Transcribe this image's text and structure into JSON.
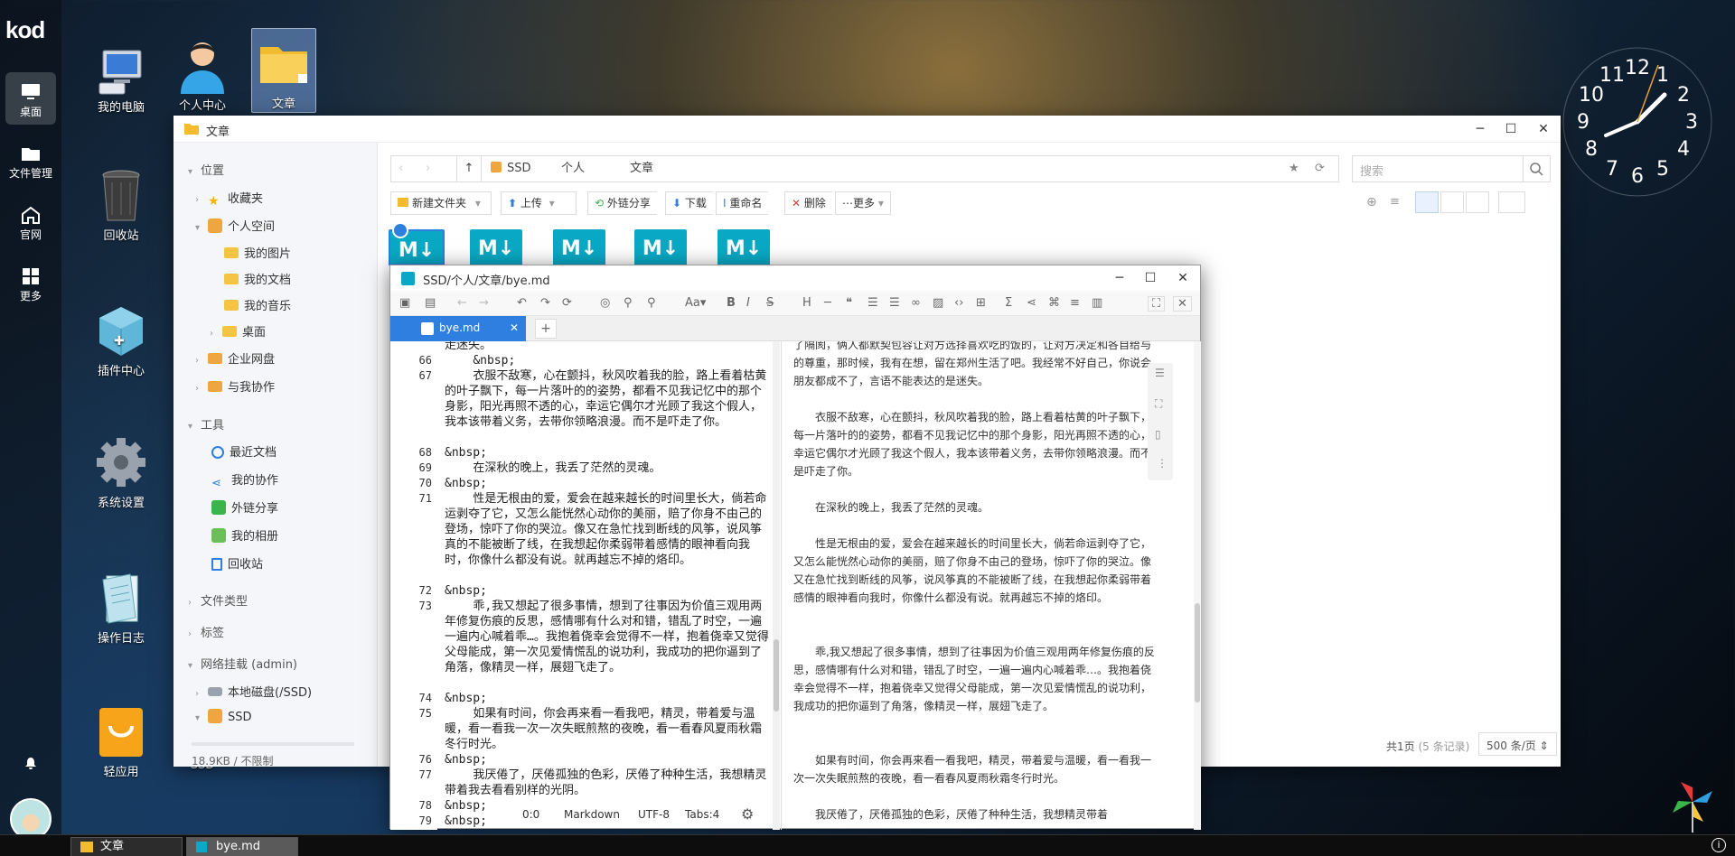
{
  "brand": "kod",
  "dock": {
    "items": [
      {
        "label": "桌面",
        "icon": "desktop-icon"
      },
      {
        "label": "文件管理",
        "icon": "folder-icon"
      },
      {
        "label": "官网",
        "icon": "home-icon"
      },
      {
        "label": "更多",
        "icon": "grid-icon"
      }
    ]
  },
  "desktop": {
    "icons": [
      {
        "label": "我的电脑",
        "icon": "computer-icon"
      },
      {
        "label": "个人中心",
        "icon": "user-icon"
      },
      {
        "label": "文章",
        "icon": "folder-icon"
      },
      {
        "label": "回收站",
        "icon": "trash-icon"
      },
      {
        "label": "插件中心",
        "icon": "plugin-icon"
      },
      {
        "label": "系统设置",
        "icon": "gear-icon"
      },
      {
        "label": "操作日志",
        "icon": "notebook-icon"
      },
      {
        "label": "轻应用",
        "icon": "bag-icon"
      },
      {
        "label": "SSD",
        "icon": "disk-icon"
      }
    ]
  },
  "clock": {
    "numbers": [
      "12",
      "1",
      "2",
      "3",
      "4",
      "5",
      "6",
      "7",
      "8",
      "9",
      "10",
      "11"
    ],
    "time": "1:36"
  },
  "explorer": {
    "title": "文章",
    "sidebar": {
      "location_label": "位置",
      "favorites": "收藏夹",
      "personal_space": "个人空间",
      "my_pictures": "我的图片",
      "my_documents": "我的文档",
      "my_music": "我的音乐",
      "desktop": "桌面",
      "enterprise_disk": "企业网盘",
      "collab_with_me": "与我协作",
      "tools_label": "工具",
      "recent_docs": "最近文档",
      "my_collab": "我的协作",
      "external_share": "外链分享",
      "my_album": "我的相册",
      "recycle": "回收站",
      "file_type": "文件类型",
      "tags": "标签",
      "network_mount": "网络挂载 (admin)",
      "local_disk": "本地磁盘(/SSD)",
      "ssd": "SSD",
      "storage": "18.9KB / 不限制"
    },
    "crumbs": [
      "SSD",
      "个人",
      "文章"
    ],
    "search_placeholder": "搜索",
    "toolbar": {
      "new_folder": "新建文件夹",
      "upload": "上传",
      "external_share": "外链分享",
      "download": "下载",
      "rename": "重命名",
      "delete": "删除",
      "more": "更多"
    },
    "thumb_label": "M↓",
    "pager": {
      "pages": "共1页",
      "records": "(5 条记录)",
      "per_page": "500 条/页"
    }
  },
  "editor": {
    "title": "SSD/个人/文章/bye.md",
    "tab": "bye.md",
    "status": {
      "cursor": "0:0",
      "mode": "Markdown",
      "encoding": "UTF-8",
      "tabs": "Tabs:4"
    },
    "lines": [
      {
        "n": "",
        "t": "走迷失。"
      },
      {
        "n": "66",
        "t": "    &nbsp;"
      },
      {
        "n": "67",
        "t": "    衣服不敌寒，心在颤抖，秋风吹着我的脸，路上看着枯黄的叶子飘下，每一片落叶的的姿势，都看不见我记忆中的那个身影，阳光再照不透的心，幸运它偶尔才光顾了我这个假人，我本该带着义务，去带你领略浪漫。而不是吓走了你。"
      },
      {
        "n": "68",
        "t": "&nbsp;"
      },
      {
        "n": "69",
        "t": "    在深秋的晚上，我丢了茫然的灵魂。"
      },
      {
        "n": "70",
        "t": "&nbsp;"
      },
      {
        "n": "71",
        "t": "    性是无根由的爱，爱会在越来越长的时间里长大，倘若命运剥夺了它，又怎么能恍然心动你的美丽，赔了你身不由己的登场，惊吓了你的哭泣。像又在急忙找到断线的风筝，说风筝真的不能被断了线，在我想起你柔弱带着感情的眼神看向我时，你像什么都没有说。就再越忘不掉的烙印。"
      },
      {
        "n": "72",
        "t": "&nbsp;"
      },
      {
        "n": "73",
        "t": "    乖,我又想起了很多事情，想到了往事因为价值三观用两年修复伤痕的反思，感情哪有什么对和错，错乱了时空，一遍一遍内心喊着乖…。我抱着侥幸会觉得不一样，抱着侥幸又觉得父母能成，第一次见爱情慌乱的说功利，我成功的把你逼到了角落，像精灵一样，展翅飞走了。"
      },
      {
        "n": "74",
        "t": "&nbsp;"
      },
      {
        "n": "75",
        "t": "    如果有时间，你会再来看一看我吧，精灵，带着爱与温暖，看一看我一次一次失眠煎熬的夜晚，看一看春风夏雨秋霜冬行时光。"
      },
      {
        "n": "76",
        "t": "&nbsp;"
      },
      {
        "n": "77",
        "t": "    我厌倦了，厌倦孤独的色彩，厌倦了种种生活，我想精灵带着我去看看别样的光阴。"
      },
      {
        "n": "78",
        "t": "&nbsp;"
      },
      {
        "n": "79",
        "t": "&nbsp;"
      }
    ],
    "preview": [
      "了隔阂，俩人都默契包容让对方选择喜欢吃的饭的，让对方决定和各自给与的尊重，那时候，我有在想，留在郑州生活了吧。我经常不好自己，你说会朋友都成不了，言语不能表达的是迷失。",
      "衣服不敌寒，心在颤抖，秋风吹着我的脸，路上看着枯黄的叶子飘下，每一片落叶的的姿势，都看不见我记忆中的那个身影，阳光再照不透的心，幸运它偶尔才光顾了我这个假人，我本该带着义务，去带你领略浪漫。而不是吓走了你。",
      "在深秋的晚上，我丢了茫然的灵魂。",
      "性是无根由的爱，爱会在越来越长的时间里长大，倘若命运剥夺了它，又怎么能恍然心动你的美丽，赔了你身不由己的登场，惊吓了你的哭泣。像又在急忙找到断线的风筝，说风筝真的不能被断了线，在我想起你柔弱带着感情的眼神看向我时，你像什么都没有说。就再越忘不掉的烙印。",
      "乖,我又想起了很多事情，想到了往事因为价值三观用两年修复伤痕的反思，感情哪有什么对和错，错乱了时空，一遍一遍内心喊着乖…。我抱着侥幸会觉得不一样，抱着侥幸又觉得父母能成，第一次见爱情慌乱的说功利，我成功的把你逼到了角落，像精灵一样，展翅飞走了。",
      "如果有时间，你会再来看一看我吧，精灵，带着爱与温暖，看一看我一次一次失眠煎熬的夜晚，看一看春风夏雨秋霜冬行时光。",
      "我厌倦了，厌倦孤独的色彩，厌倦了种种生活，我想精灵带着"
    ]
  },
  "taskbar": {
    "items": [
      "文章",
      "bye.md"
    ]
  },
  "colors": {
    "accent": "#2f7fe0",
    "folder": "#f5c443",
    "md": "#09a9c5"
  }
}
